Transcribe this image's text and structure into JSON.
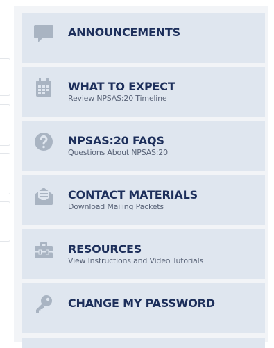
{
  "colors": {
    "tile_background": "#dfe6ef",
    "panel_background": "#f2f4f7",
    "title_text": "#1d2f5b",
    "subtitle_text": "#5a6478",
    "icon": "#a9b4c2"
  },
  "menu": {
    "items": [
      {
        "title": "ANNOUNCEMENTS",
        "subtitle": "",
        "icon": "speech-bubble-icon"
      },
      {
        "title": "WHAT TO EXPECT",
        "subtitle": "Review NPSAS:20 Timeline",
        "icon": "calendar-icon"
      },
      {
        "title": "NPSAS:20 FAQS",
        "subtitle": "Questions About NPSAS:20",
        "icon": "question-circle-icon"
      },
      {
        "title": "CONTACT MATERIALS",
        "subtitle": "Download Mailing Packets",
        "icon": "envelope-open-icon"
      },
      {
        "title": "RESOURCES",
        "subtitle": "View Instructions and Video Tutorials",
        "icon": "toolbox-icon"
      },
      {
        "title": "CHANGE MY PASSWORD",
        "subtitle": "",
        "icon": "key-icon"
      }
    ]
  }
}
